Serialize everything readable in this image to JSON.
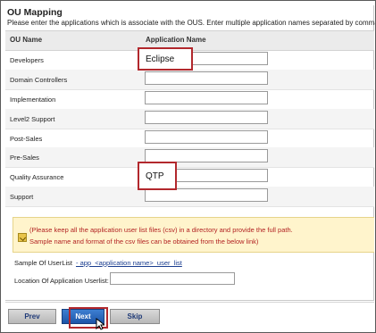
{
  "header": {
    "title": "OU Mapping",
    "subtitle": "Please enter the applications which is associate with the OUS. Enter multiple application names separated by commas."
  },
  "grid": {
    "col_ou": "OU Name",
    "col_app": "Application Name",
    "rows": [
      {
        "ou": "Developers",
        "app": "Eclipse"
      },
      {
        "ou": "Domain Controllers",
        "app": ""
      },
      {
        "ou": "Implementation",
        "app": ""
      },
      {
        "ou": "Level2 Support",
        "app": ""
      },
      {
        "ou": "Post-Sales",
        "app": ""
      },
      {
        "ou": "Pre-Sales",
        "app": ""
      },
      {
        "ou": "Quality Assurance",
        "app": "QTP"
      },
      {
        "ou": "Support",
        "app": ""
      }
    ]
  },
  "notice": {
    "line1": "(Please keep all the application user list files (csv) in a directory and provide the full path.",
    "line2": "Sample name and format of the csv files can be obtained from the below link)"
  },
  "sample": {
    "label": "Sample Of UserList",
    "link": "- app_<application name>_user_list"
  },
  "location": {
    "label": "Location Of Application Userlist:",
    "value": ""
  },
  "buttons": {
    "prev": "Prev",
    "next": "Next",
    "skip": "Skip"
  },
  "colors": {
    "highlight": "#b2282d",
    "next_button": "#1d55a8",
    "notice_bg": "#fff4cc",
    "notice_text": "#b22222"
  },
  "icons": {
    "notice": "warning-icon",
    "pointer": "mouse-cursor-icon"
  }
}
